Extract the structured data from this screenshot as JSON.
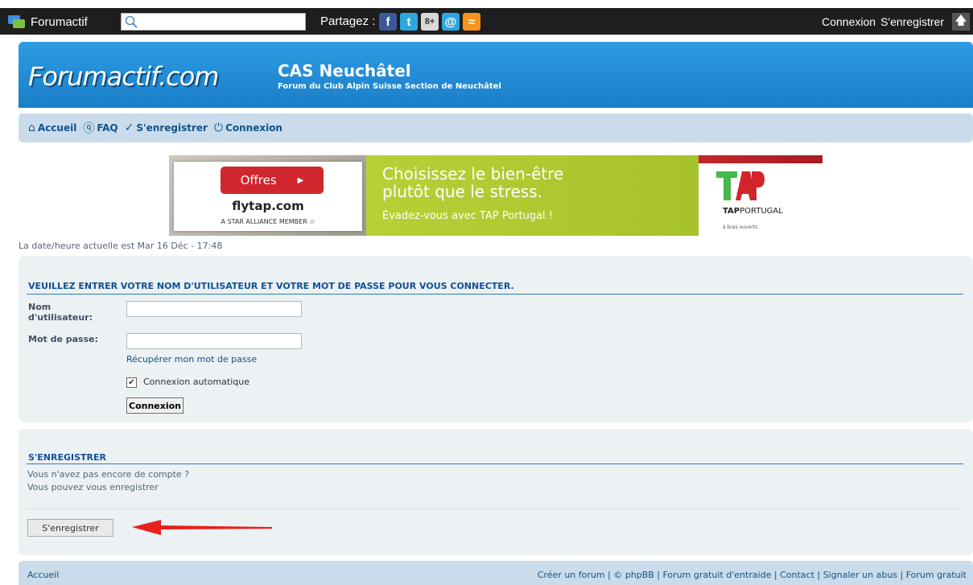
{
  "topbar": {
    "brand": "Forumactif",
    "search_placeholder": "",
    "share_label": "Partagez :",
    "social": [
      {
        "name": "facebook-icon",
        "glyph": "f"
      },
      {
        "name": "twitter-icon",
        "glyph": "t"
      },
      {
        "name": "google-plus-icon",
        "glyph": "8+"
      },
      {
        "name": "email-icon",
        "glyph": "@"
      },
      {
        "name": "rss-icon",
        "glyph": "≈"
      }
    ],
    "login_label": "Connexion",
    "register_label": "S'enregistrer",
    "up_icon": "arrow-up-icon"
  },
  "header": {
    "brand": "Forumactif.com",
    "title": "CAS Neuchâtel",
    "description": "Forum du Club Alpin Suisse Section de Neuchâtel"
  },
  "nav": {
    "items": [
      {
        "label": "Accueil",
        "icon": "⌂"
      },
      {
        "label": "FAQ",
        "icon": "?"
      },
      {
        "label": "S'enregistrer",
        "icon": "✓"
      },
      {
        "label": "Connexion",
        "icon": "⏻"
      }
    ]
  },
  "ad": {
    "offers": "Offres",
    "site": "flytap.com",
    "alliance": "A STAR ALLIANCE MEMBER ☆",
    "headline1": "Choisissez le bien-être",
    "headline2": "plutôt que le stress.",
    "subline": "Évadez-vous avec TAP Portugal !",
    "brand_bold": "TAP",
    "brand_rest": "PORTUGAL",
    "tagline": "à bras ouverts"
  },
  "datetime": "La date/heure actuelle est Mar 16 Déc - 17:48",
  "login": {
    "heading": "Veuillez entrer votre nom d'utilisateur et votre mot de passe pour vous connecter.",
    "username_label_1": "Nom",
    "username_label_2": "d'utilisateur:",
    "username_value": "",
    "password_label": "Mot de passe:",
    "password_value": "",
    "forgot_link": "Récupérer mon mot de passe",
    "auto_login_label": "Connexion automatique",
    "auto_login_checked": true,
    "submit_label": "Connexion"
  },
  "register": {
    "heading": "S'enregistrer",
    "line1": "Vous n'avez pas encore de compte ?",
    "line2": "Vous pouvez vous enregistrer",
    "button_label": "S'enregistrer"
  },
  "footer": {
    "left": "Accueil",
    "right": "Créer un forum | © phpBB | Forum gratuit d'entraide | Contact | Signaler un abus | Forum gratuit"
  },
  "colors": {
    "topbar_bg": "#1e1e1e",
    "header_blue": "#2d9be3",
    "navbar_bg": "#cadceb",
    "panel_bg": "#ecf1f3",
    "link": "#105289",
    "arrow_red": "#e8201c"
  }
}
